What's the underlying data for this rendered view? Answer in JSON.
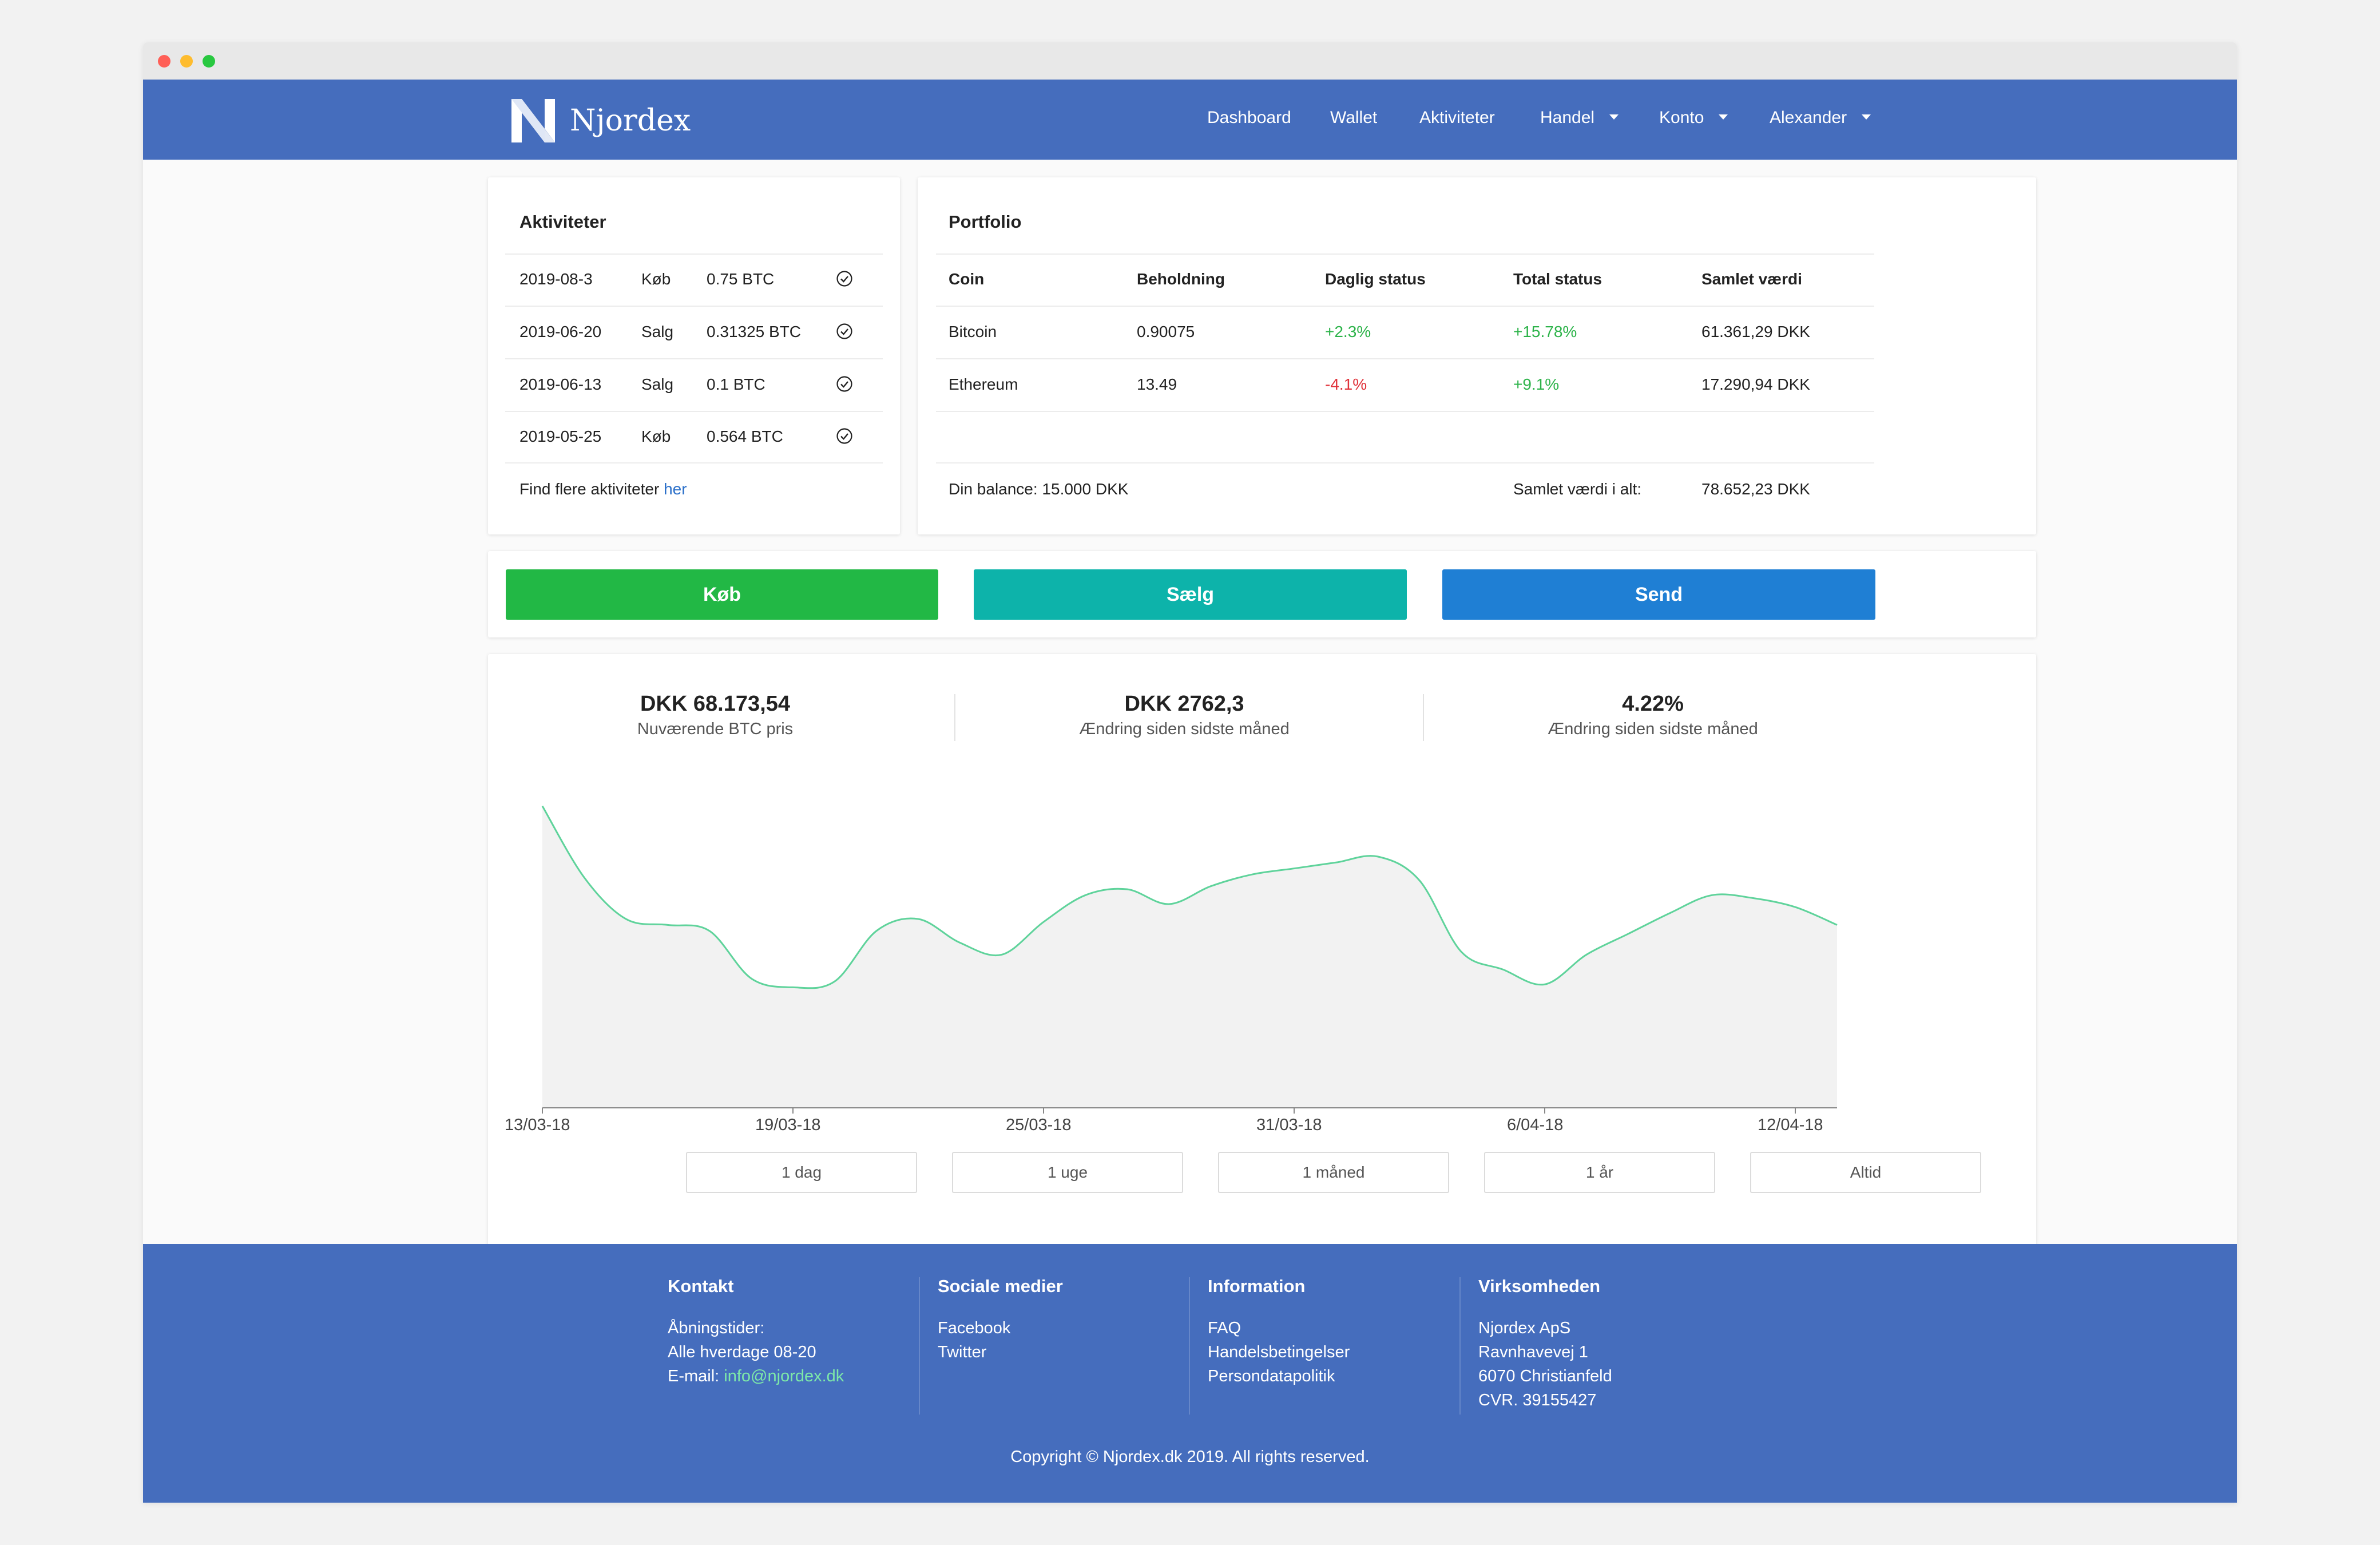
{
  "nav": {
    "brand": "Njordex",
    "items": [
      "Dashboard",
      "Wallet",
      "Aktiviteter",
      "Handel",
      "Konto",
      "Alexander"
    ]
  },
  "activities": {
    "title": "Aktiviteter",
    "rows": [
      {
        "date": "2019-08-3",
        "type": "Køb",
        "amount": "0.75 BTC"
      },
      {
        "date": "2019-06-20",
        "type": "Salg",
        "amount": "0.31325 BTC"
      },
      {
        "date": "2019-06-13",
        "type": "Salg",
        "amount": "0.1 BTC"
      },
      {
        "date": "2019-05-25",
        "type": "Køb",
        "amount": "0.564 BTC"
      }
    ],
    "more_text": "Find flere aktiviteter ",
    "more_link": "her"
  },
  "portfolio": {
    "title": "Portfolio",
    "headers": [
      "Coin",
      "Beholdning",
      "Daglig status",
      "Total status",
      "Samlet værdi"
    ],
    "rows": [
      {
        "coin": "Bitcoin",
        "holding": "0.90075",
        "daily": "+2.3%",
        "total": "+15.78%",
        "value": "61.361,29 DKK"
      },
      {
        "coin": "Ethereum",
        "holding": "13.49",
        "daily": "-4.1%",
        "total": "+9.1%",
        "value": "17.290,94 DKK"
      }
    ],
    "balance": "Din balance: 15.000 DKK",
    "total_label": "Samlet værdi i alt:",
    "total_value": "78.652,23 DKK"
  },
  "actions": {
    "buy": "Køb",
    "sell": "Sælg",
    "send": "Send"
  },
  "stats": [
    {
      "value": "DKK 68.173,54",
      "label": "Nuværende BTC pris"
    },
    {
      "value": "DKK 2762,3",
      "label": "Ændring siden sidste måned"
    },
    {
      "value": "4.22%",
      "label": "Ændring siden sidste måned"
    }
  ],
  "chart_data": {
    "type": "area",
    "x": [
      "13/03-18",
      "14/03-18",
      "15/03-18",
      "16/03-18",
      "17/03-18",
      "18/03-18",
      "19/03-18",
      "20/03-18",
      "21/03-18",
      "22/03-18",
      "23/03-18",
      "24/03-18",
      "25/03-18",
      "26/03-18",
      "27/03-18",
      "28/03-18",
      "29/03-18",
      "30/03-18",
      "31/03-18",
      "01/04-18",
      "02/04-18",
      "03/04-18",
      "04/04-18",
      "05/04-18",
      "06/04-18",
      "07/04-18",
      "08/04-18",
      "09/04-18",
      "10/04-18",
      "11/04-18",
      "12/04-18",
      "13/04-18"
    ],
    "values": [
      100,
      76,
      62,
      60,
      58,
      42,
      39,
      41,
      58,
      62,
      54,
      50,
      61,
      70,
      72,
      67,
      73,
      77,
      79,
      81,
      83,
      75,
      51,
      45,
      40,
      50,
      57,
      64,
      70,
      69,
      66,
      60
    ],
    "tick_labels": [
      "13/03-18",
      "19/03-18",
      "25/03-18",
      "31/03-18",
      "6/04-18",
      "12/04-18"
    ],
    "ylim": [
      0,
      100
    ],
    "grid": false,
    "colors": {
      "line": "#5fd39b",
      "fill": "#f2f2f2",
      "axis": "#888888"
    }
  },
  "ranges": [
    "1 dag",
    "1 uge",
    "1 måned",
    "1 år",
    "Altid"
  ],
  "footer": {
    "contact": {
      "title": "Kontakt",
      "lines": [
        "Åbningstider:",
        "Alle hverdage 08-20"
      ],
      "email_label": "E-mail: ",
      "email": "info@njordex.dk"
    },
    "social": {
      "title": "Sociale medier",
      "links": [
        "Facebook",
        "Twitter"
      ]
    },
    "info": {
      "title": "Information",
      "links": [
        "FAQ",
        "Handelsbetingelser",
        "Persondatapolitik"
      ]
    },
    "company": {
      "title": "Virksomheden",
      "lines": [
        "Njordex ApS",
        "Ravnhavevej 1",
        "6070 Christianfeld",
        "CVR. 39155427"
      ]
    },
    "copyright": "Copyright © Njordex.dk 2019. All rights reserved."
  },
  "colors": {
    "nav_bg": "#456dbd",
    "buy": "#22b845",
    "sell": "#0db3aa",
    "send": "#1f7fd4",
    "positive": "#2db34a",
    "negative": "#e0333b"
  }
}
